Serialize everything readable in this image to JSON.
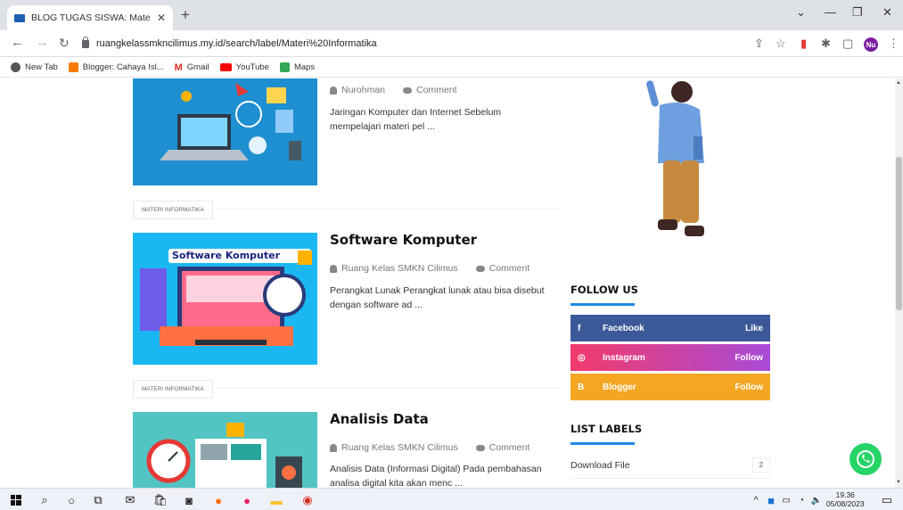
{
  "browser": {
    "tab_title": "BLOG TUGAS SISWA: Materi Infor",
    "url": "ruangkelassmkncilimus.my.id/search/label/Materi%20Informatika",
    "profile_initials": "Nu",
    "bookmarks": [
      {
        "label": "New Tab",
        "icon": "globe-icon",
        "color": "#555555"
      },
      {
        "label": "Blogger: Cahaya Isl...",
        "icon": "blogger-icon",
        "color": "#f57c00"
      },
      {
        "label": "Gmail",
        "icon": "gmail-icon",
        "color": "#d93025"
      },
      {
        "label": "YouTube",
        "icon": "youtube-icon",
        "color": "#ff0000"
      },
      {
        "label": "Maps",
        "icon": "maps-icon",
        "color": "#34a853"
      }
    ]
  },
  "posts": [
    {
      "author": "Nurohman",
      "comment": "Comment",
      "excerpt": "Jaringan Komputer dan Internet     Sebelum mempelajari materi pel ..."
    },
    {
      "tag": "MATERI INFORMATIKA",
      "title": "Software Komputer",
      "image_text": "Software Komputer",
      "author": "Ruang Kelas SMKN Cilimus",
      "comment": "Comment",
      "excerpt": "Perangkat Lunak    Perangkat lunak atau bisa disebut dengan software ad ..."
    },
    {
      "tag": "MATERI INFORMATIKA",
      "title": "Analisis Data",
      "author": "Ruang Kelas SMKN Cilimus",
      "comment": "Comment",
      "excerpt": "Analisis Data (Informasi Digital)   Pada pembahasan analisa digital kita akan menc ..."
    }
  ],
  "sidebar": {
    "follow_title": "FOLLOW US",
    "social": [
      {
        "icon": "f",
        "name": "Facebook",
        "action": "Like",
        "color": "#3b5998"
      },
      {
        "icon": "◎",
        "name": "Instagram",
        "action": "Follow",
        "color": "#d6249f"
      },
      {
        "icon": "B",
        "name": "Blogger",
        "action": "Follow",
        "color": "#f5a623"
      }
    ],
    "labels_title": "LIST LABELS",
    "labels": [
      {
        "name": "Download File",
        "count": "2"
      }
    ]
  },
  "taskbar": {
    "time": "19.36",
    "date": "05/08/2023"
  }
}
